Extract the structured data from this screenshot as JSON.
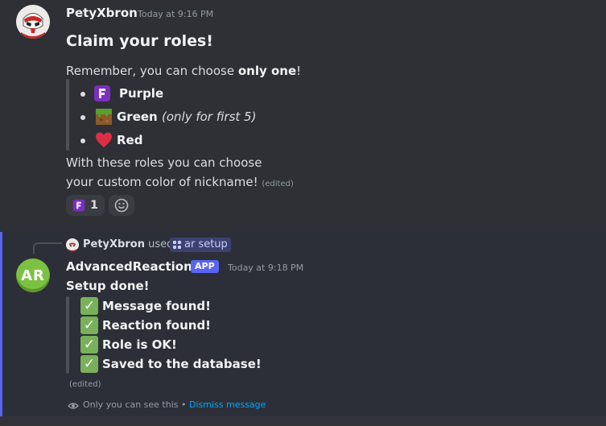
{
  "message1": {
    "author": "PetyXbron",
    "timestamp": "Today at 9:16 PM",
    "heading": "Claim your roles!",
    "intro_prefix": "Remember, you can choose ",
    "intro_bold": "only one",
    "intro_suffix": "!",
    "roles": [
      {
        "name": "Purple",
        "note": "",
        "icon": "purple-role-icon"
      },
      {
        "name": "Green",
        "note": "(only for first 5)",
        "icon": "grass-block-icon"
      },
      {
        "name": "Red",
        "note": "",
        "icon": "red-heart-icon"
      }
    ],
    "outro_line1": "With these roles you can choose",
    "outro_line2": "your custom color of nickname!",
    "edited": "(edited)",
    "reactions": [
      {
        "icon": "purple-role-icon",
        "count": "1"
      },
      {
        "icon": "add-reaction-icon",
        "count": ""
      }
    ]
  },
  "message2": {
    "used_by": "PetyXbron",
    "used_word": "used",
    "command": "ar setup",
    "author": "AdvancedReactions",
    "avatar_text": "AR",
    "badge": "APP",
    "timestamp": "Today at 9:18 PM",
    "title": "Setup done!",
    "checks": [
      "Message found!",
      "Reaction found!",
      "Role is OK!",
      "Saved to the database!"
    ],
    "edited": "(edited)",
    "ephemeral_note": "Only you can see this",
    "separator": "•",
    "dismiss": "Dismiss message"
  },
  "colors": {
    "accent": "#5865f2",
    "link": "#00a8fc",
    "check": "#78b159"
  }
}
